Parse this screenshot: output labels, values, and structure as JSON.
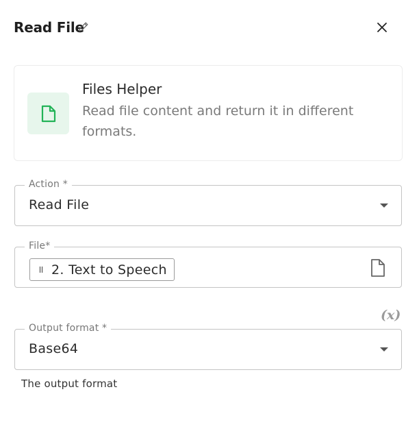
{
  "header": {
    "title": "Read File",
    "edit_icon": "pencil-icon",
    "close_icon": "close-icon"
  },
  "card": {
    "icon": "file-icon",
    "title": "Files Helper",
    "description": "Read file content and return it in different formats."
  },
  "fields": {
    "action": {
      "label": "Action *",
      "value": "Read File"
    },
    "file": {
      "label": "File*",
      "chip_label": "2. Text to Speech",
      "icon": "file-outline-icon"
    },
    "output_format": {
      "label": "Output format *",
      "value": "Base64",
      "helper": "The output format"
    }
  },
  "fx_toggle": {
    "label": "(x)"
  },
  "colors": {
    "accent_green": "#22b357",
    "icon_bg": "#e7f6ec",
    "border": "#c4c4c4"
  }
}
